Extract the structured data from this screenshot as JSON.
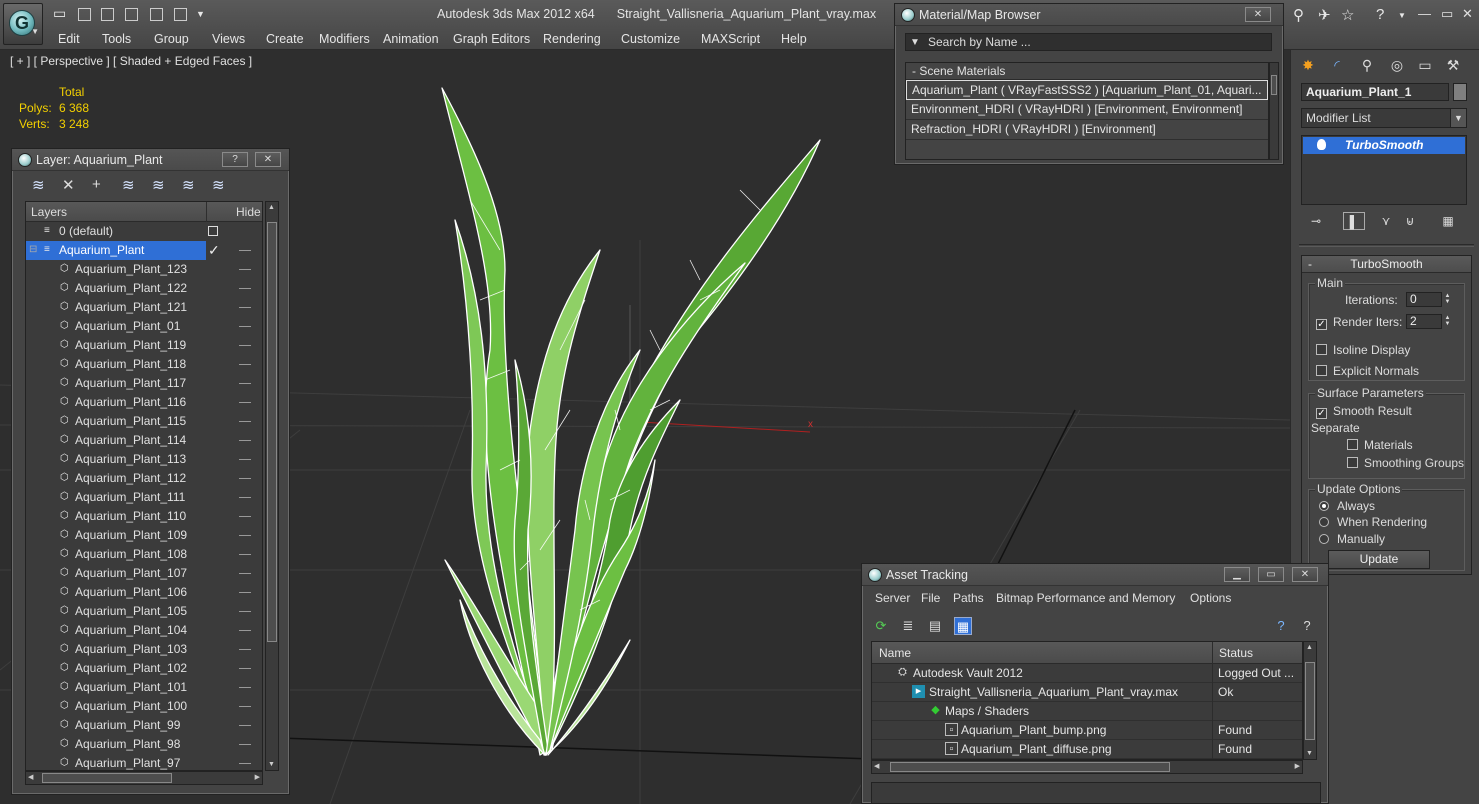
{
  "app": {
    "title": "Autodesk 3ds Max  2012 x64",
    "file": "Straight_Vallisneria_Aquarium_Plant_vray.max",
    "menu": [
      "Edit",
      "Tools",
      "Group",
      "Views",
      "Create",
      "Modifiers",
      "Animation",
      "Graph Editors",
      "Rendering",
      "Customize",
      "MAXScript",
      "Help"
    ]
  },
  "viewport": {
    "label": "[ + ] [ Perspective ] [ Shaded + Edged Faces ]",
    "stats": {
      "header": "Total",
      "polys_label": "Polys:",
      "polys_value": "6 368",
      "verts_label": "Verts:",
      "verts_value": "3 248"
    },
    "axis_label": "x"
  },
  "layer_window": {
    "title": "Layer: Aquarium_Plant",
    "help_button": "?",
    "close_button": "✕",
    "columns": {
      "name": "Layers",
      "hide": "Hide"
    },
    "default_layer": "0 (default)",
    "active_layer": "Aquarium_Plant",
    "objects": [
      "Aquarium_Plant_123",
      "Aquarium_Plant_122",
      "Aquarium_Plant_121",
      "Aquarium_Plant_01",
      "Aquarium_Plant_119",
      "Aquarium_Plant_118",
      "Aquarium_Plant_117",
      "Aquarium_Plant_116",
      "Aquarium_Plant_115",
      "Aquarium_Plant_114",
      "Aquarium_Plant_113",
      "Aquarium_Plant_112",
      "Aquarium_Plant_111",
      "Aquarium_Plant_110",
      "Aquarium_Plant_109",
      "Aquarium_Plant_108",
      "Aquarium_Plant_107",
      "Aquarium_Plant_106",
      "Aquarium_Plant_105",
      "Aquarium_Plant_104",
      "Aquarium_Plant_103",
      "Aquarium_Plant_102",
      "Aquarium_Plant_101",
      "Aquarium_Plant_100",
      "Aquarium_Plant_99",
      "Aquarium_Plant_98",
      "Aquarium_Plant_97"
    ]
  },
  "material_browser": {
    "title": "Material/Map Browser",
    "search_placeholder": "Search by Name ...",
    "section": "- Scene Materials",
    "materials": [
      "Aquarium_Plant  ( VRayFastSSS2 )  [Aquarium_Plant_01, Aquari...",
      "Environment_HDRI  ( VRayHDRI ) [Environment, Environment]",
      "Refraction_HDRI  ( VRayHDRI ) [Environment]"
    ]
  },
  "command_panel": {
    "object_name": "Aquarium_Plant_1",
    "modifier_list": "Modifier List",
    "modifier": "TurboSmooth",
    "rollout_title": "TurboSmooth",
    "main_label": "Main",
    "iterations_label": "Iterations:",
    "iterations_value": "0",
    "render_iters_label": "Render Iters:",
    "render_iters_value": "2",
    "isoline_label": "Isoline Display",
    "explicit_normals_label": "Explicit Normals",
    "surface_params_label": "Surface Parameters",
    "smooth_result_label": "Smooth Result",
    "separate_label": "Separate",
    "materials_label": "Materials",
    "smoothing_groups_label": "Smoothing Groups",
    "update_options_label": "Update Options",
    "always_label": "Always",
    "when_rendering_label": "When Rendering",
    "manually_label": "Manually",
    "update_button": "Update"
  },
  "asset_tracking": {
    "title": "Asset Tracking",
    "menu": [
      "Server",
      "File",
      "Paths",
      "Bitmap Performance and Memory",
      "Options"
    ],
    "columns": {
      "name": "Name",
      "status": "Status"
    },
    "rows": [
      {
        "name": "Autodesk Vault 2012",
        "status": "Logged Out ..."
      },
      {
        "name": "Straight_Vallisneria_Aquarium_Plant_vray.max",
        "status": "Ok"
      },
      {
        "name": "Maps / Shaders",
        "status": ""
      },
      {
        "name": "Aquarium_Plant_bump.png",
        "status": "Found"
      },
      {
        "name": "Aquarium_Plant_diffuse.png",
        "status": "Found"
      }
    ]
  },
  "colors": {
    "selection": "#2f6fd6",
    "stats_text": "#f3d000",
    "leaf_green": "#5fb43a",
    "viewport_bg": "#2e2e2e"
  }
}
